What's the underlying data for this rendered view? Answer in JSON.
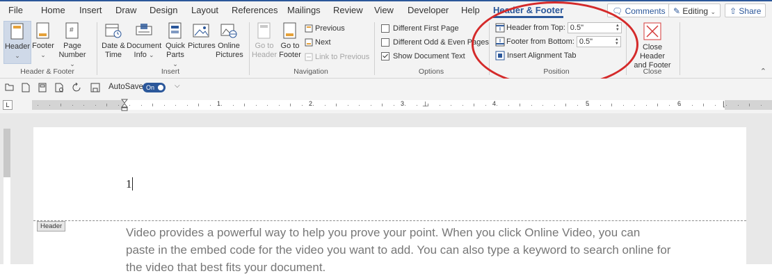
{
  "menu": {
    "tabs": [
      "File",
      "Home",
      "Insert",
      "Draw",
      "Design",
      "Layout",
      "References",
      "Mailings",
      "Review",
      "View",
      "Developer",
      "Help",
      "Header & Footer"
    ],
    "active_tab": "Header & Footer",
    "comments_label": "Comments",
    "editing_label": "Editing",
    "share_label": "Share"
  },
  "ribbon": {
    "header_footer_group": {
      "label": "Header & Footer",
      "header": "Header",
      "footer": "Footer",
      "page_number_line1": "Page",
      "page_number_line2": "Number"
    },
    "insert_group": {
      "label": "Insert",
      "date_time_line1": "Date &",
      "date_time_line2": "Time",
      "document_info_line1": "Document",
      "document_info_line2": "Info",
      "quick_parts_line1": "Quick",
      "quick_parts_line2": "Parts",
      "pictures": "Pictures",
      "online_pictures_line1": "Online",
      "online_pictures_line2": "Pictures"
    },
    "navigation_group": {
      "label": "Navigation",
      "goto_header_line1": "Go to",
      "goto_header_line2": "Header",
      "goto_footer_line1": "Go to",
      "goto_footer_line2": "Footer",
      "previous": "Previous",
      "next": "Next",
      "link_to_previous": "Link to Previous"
    },
    "options_group": {
      "label": "Options",
      "different_first_page": "Different First Page",
      "different_first_page_checked": false,
      "different_odd_even": "Different Odd & Even Pages",
      "different_odd_even_checked": false,
      "show_document_text": "Show Document Text",
      "show_document_text_checked": true
    },
    "position_group": {
      "label": "Position",
      "header_from_top_label": "Header from Top:",
      "header_from_top_value": "0.5\"",
      "footer_from_bottom_label": "Footer from Bottom:",
      "footer_from_bottom_value": "0.5\"",
      "insert_alignment_tab": "Insert Alignment Tab"
    },
    "close_group": {
      "label": "Close",
      "close_line1": "Close Header",
      "close_line2": "and Footer"
    }
  },
  "qat": {
    "autosave_label": "AutoSave",
    "autosave_state": "On"
  },
  "ruler": {
    "numbers": [
      "1",
      "2",
      "3",
      "4",
      "5",
      "6"
    ]
  },
  "document": {
    "header_text": "1",
    "header_tag": "Header",
    "body_lines": [
      "Video provides a powerful way to help you prove your point. When you click Online Video, you can",
      "paste in the embed code for the video you want to add. You can also type a keyword to search online for",
      "the video that best fits your document."
    ]
  },
  "colors": {
    "accent": "#2b579a",
    "annotation": "#d42a2a",
    "ribbon_bg": "#f3f3f3"
  }
}
